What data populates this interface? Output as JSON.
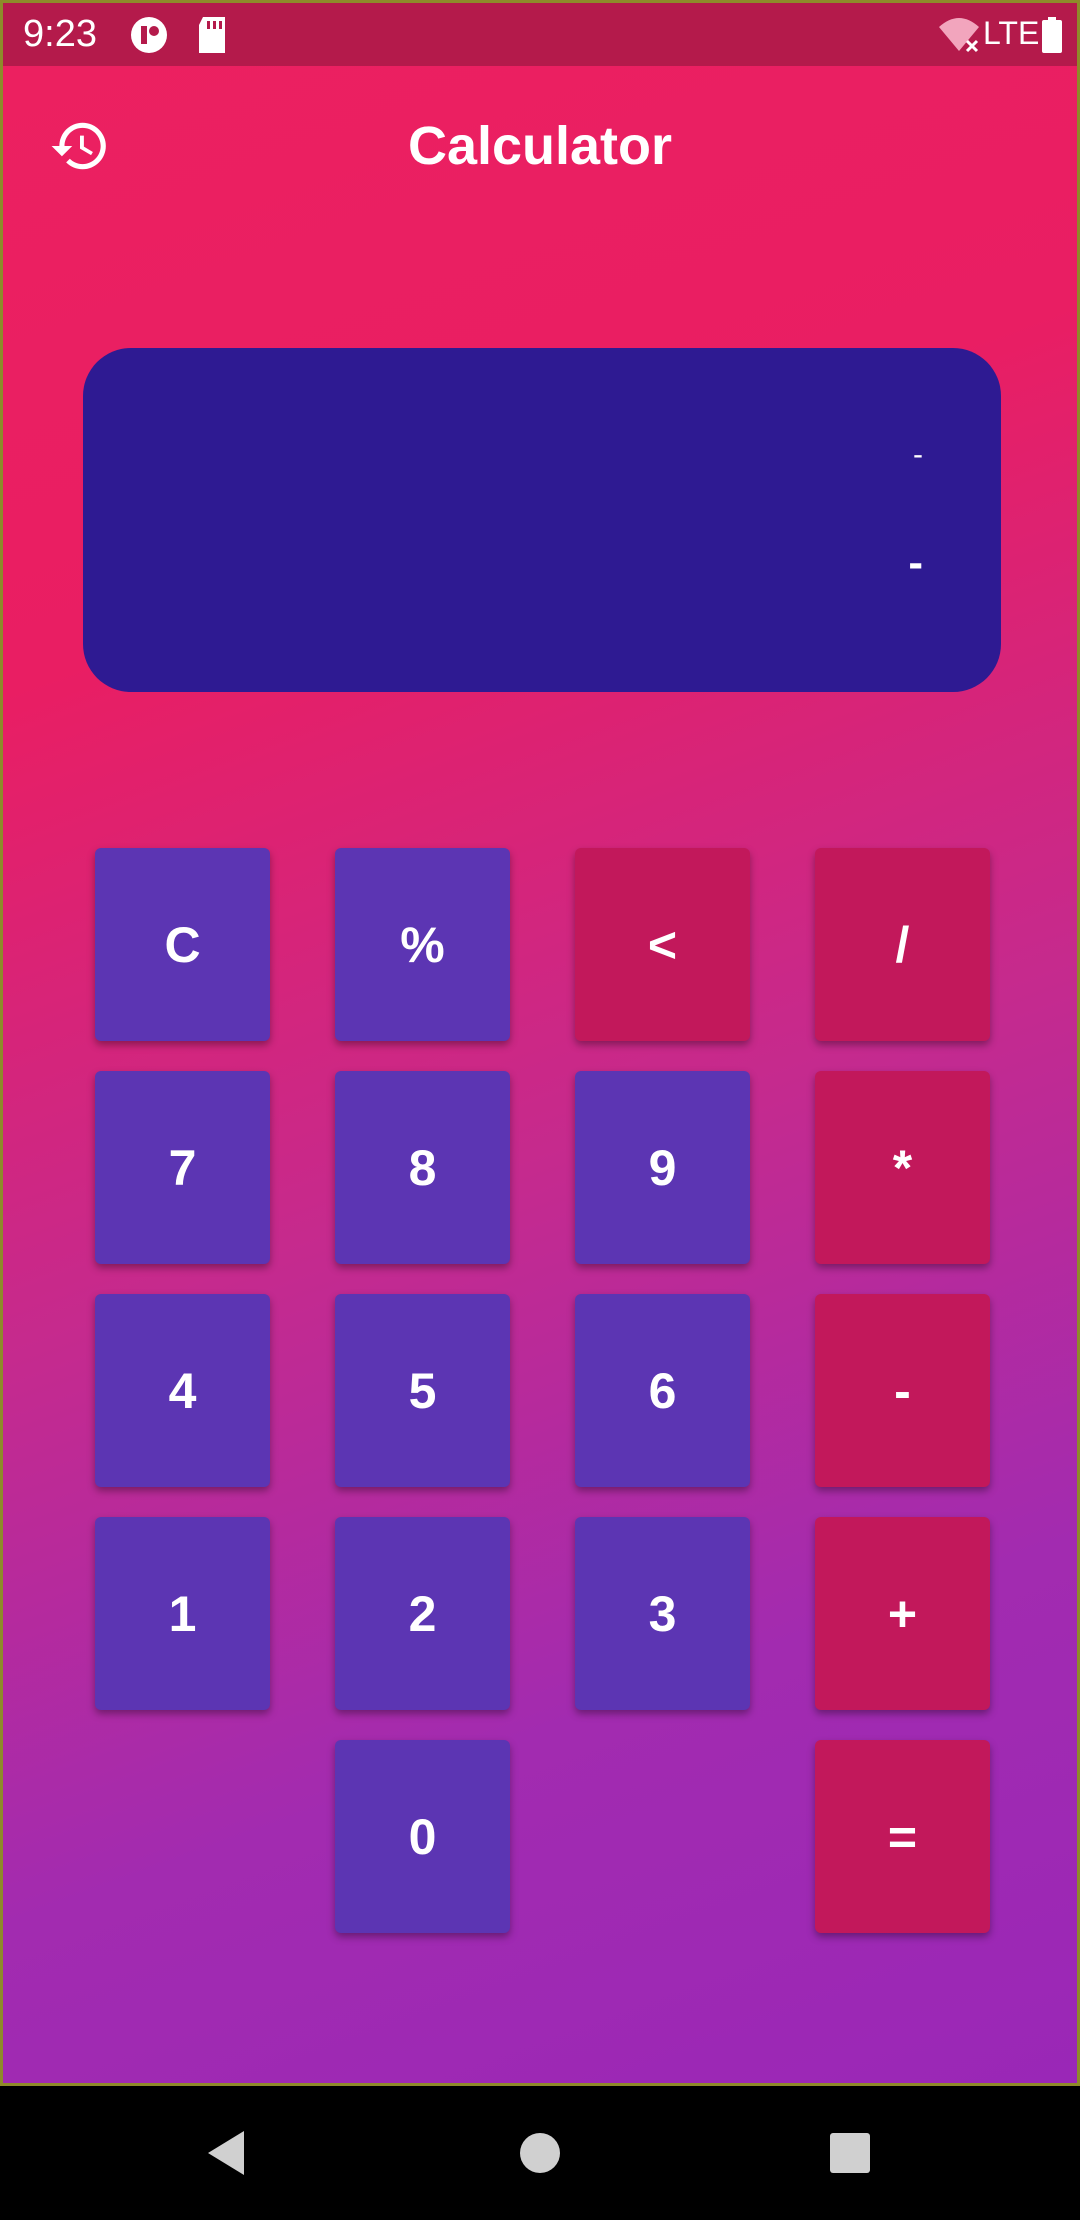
{
  "status_bar": {
    "time": "9:23",
    "network": "LTE"
  },
  "app_bar": {
    "title": "Calculator",
    "history_icon": "history-icon"
  },
  "display": {
    "expression": "-",
    "result": "-"
  },
  "keypad": {
    "rows": [
      [
        "C",
        "%",
        "<",
        "/"
      ],
      [
        "7",
        "8",
        "9",
        "*"
      ],
      [
        "4",
        "5",
        "6",
        "-"
      ],
      [
        "1",
        "2",
        "3",
        "+"
      ],
      [
        "",
        "0",
        "",
        "="
      ]
    ]
  },
  "colors": {
    "number_key": "#5c35b3",
    "operator_key": "#c2185b",
    "display_bg": "#2e1a92",
    "status_bar": "#b41a4b"
  },
  "nav": {
    "back": "back-icon",
    "home": "home-icon",
    "recents": "recents-icon"
  }
}
